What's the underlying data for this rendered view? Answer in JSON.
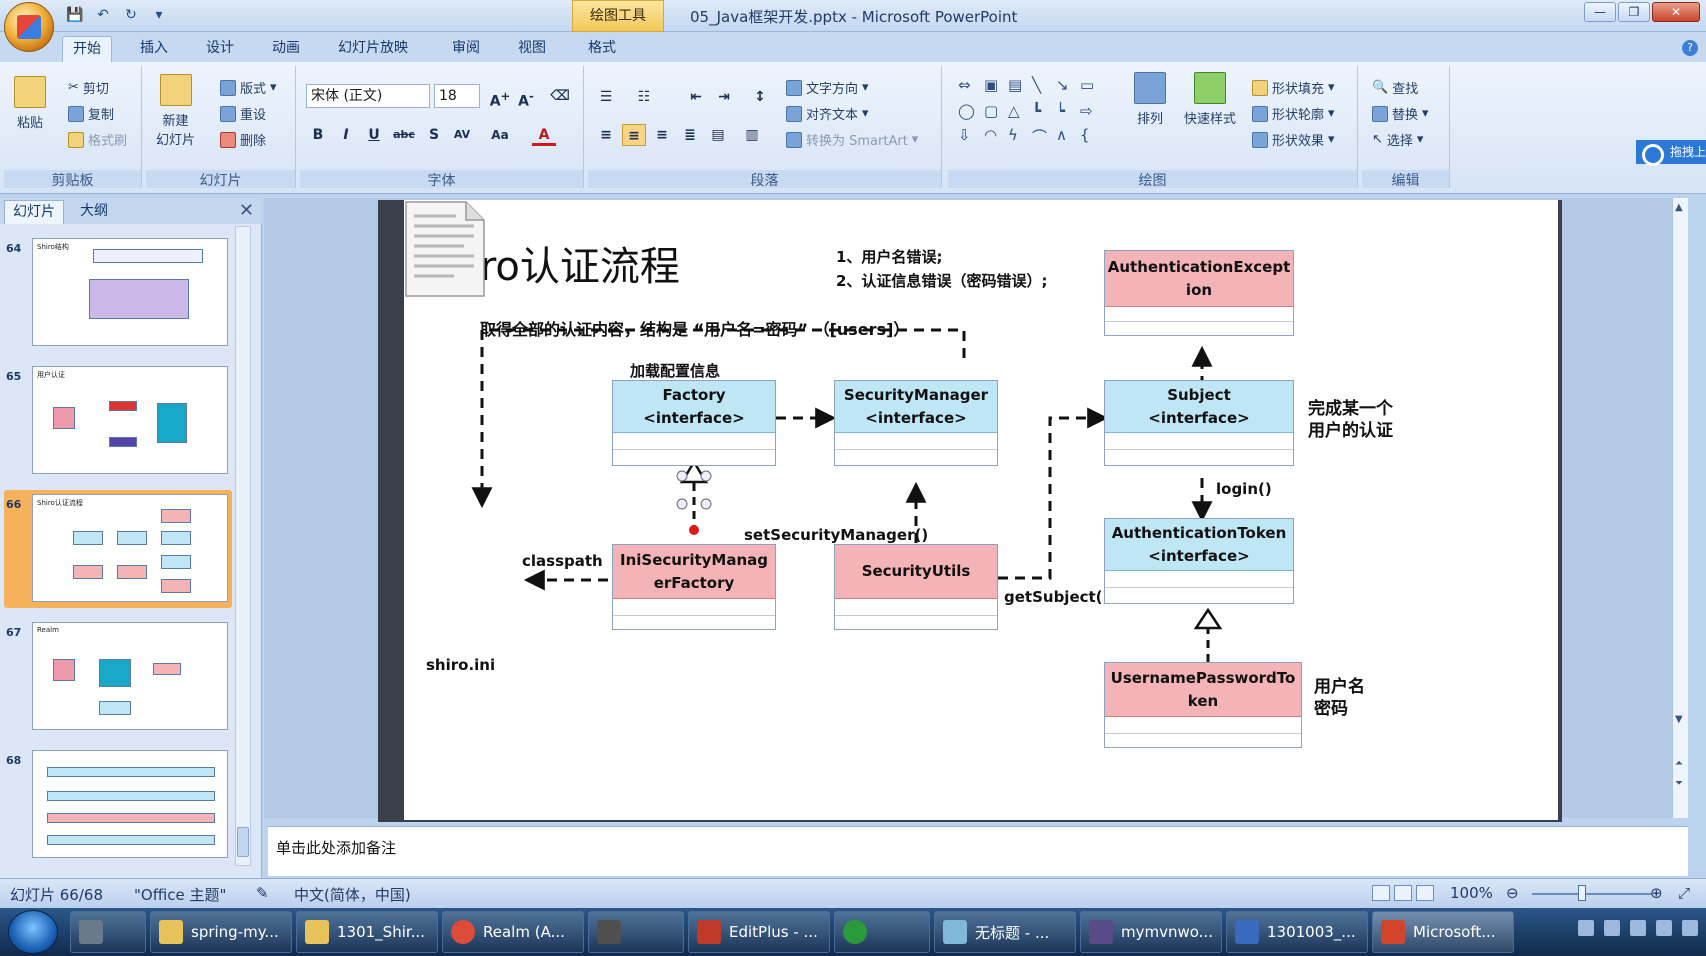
{
  "titlebar": {
    "context_tab": "绘图工具",
    "title": "05_Java框架开发.pptx - Microsoft PowerPoint"
  },
  "tabs": [
    "开始",
    "插入",
    "设计",
    "动画",
    "幻灯片放映",
    "审阅",
    "视图",
    "格式"
  ],
  "ribbon": {
    "clipboard": {
      "paste": "粘贴",
      "cut": "剪切",
      "copy": "复制",
      "format_painter": "格式刷",
      "label": "剪贴板"
    },
    "slides": {
      "new_slide": "新建\n幻灯片",
      "layout": "版式",
      "reset": "重设",
      "delete": "删除",
      "label": "幻灯片"
    },
    "font": {
      "name": "宋体 (正文)",
      "size": "18",
      "label": "字体"
    },
    "paragraph": {
      "text_direction": "文字方向",
      "align_text": "对齐文本",
      "smartart": "转换为 SmartArt",
      "label": "段落"
    },
    "drawing": {
      "arrange": "排列",
      "quick_styles": "快速样式",
      "shape_fill": "形状填充",
      "shape_outline": "形状轮廓",
      "shape_effects": "形状效果",
      "label": "绘图"
    },
    "editing": {
      "find": "查找",
      "replace": "替换",
      "select": "选择",
      "label": "编辑"
    },
    "share": "拖拽上"
  },
  "panel": {
    "tab_slides": "幻灯片",
    "tab_outline": "大纲",
    "thumbnails": [
      {
        "num": "64",
        "title": "Shiro结构"
      },
      {
        "num": "65",
        "title": "用户认证"
      },
      {
        "num": "66",
        "title": "Shiro认证流程"
      },
      {
        "num": "67",
        "title": "Realm"
      },
      {
        "num": "68",
        "title": ""
      }
    ]
  },
  "slide": {
    "title": "Shiro认证流程",
    "errors_1": "1、用户名错误;",
    "errors_2": "2、认证信息错误（密码错误）;",
    "get_all": "取得全部的认证内容，结构是 “用户名=密码” （[users]）",
    "load_config": "加载配置信息",
    "classpath": "classpath",
    "shiro_ini": "shiro.ini",
    "set_sm": "setSecurityManager()",
    "get_subject": "getSubject()",
    "login": "login()",
    "complete_1": "完成某一个",
    "complete_2": "用户的认证",
    "user_pwd_1": "用户名",
    "user_pwd_2": "密码",
    "boxes": {
      "factory": "Factory\n<interface>",
      "security_manager": "SecurityManager\n<interface>",
      "subject": "Subject\n<interface>",
      "auth_exception": "AuthenticationExcept\nion",
      "ini_factory": "IniSecurityManag\nerFactory",
      "security_utils": "SecurityUtils",
      "auth_token": "AuthenticationToken\n<interface>",
      "up_token": "UsernamePasswordTo\nken"
    }
  },
  "notes": "单击此处添加备注",
  "status": {
    "slide_counter": "幻灯片 66/68",
    "theme": "\"Office 主题\"",
    "language": "中文(简体，中国)",
    "zoom": "100%"
  },
  "taskbar": [
    {
      "label": "spring-my...",
      "color": "#e8c25a"
    },
    {
      "label": "1301_Shir...",
      "color": "#e8c25a"
    },
    {
      "label": "Realm (A...",
      "color": "#dd4b39"
    },
    {
      "label": "",
      "color": "#4f4f4f"
    },
    {
      "label": "EditPlus - ...",
      "color": "#c03a2a"
    },
    {
      "label": "",
      "color": "#2a9a3a"
    },
    {
      "label": "无标题 - ...",
      "color": "#7fb8d8"
    },
    {
      "label": "mymvnwo...",
      "color": "#5a4a8a"
    },
    {
      "label": "1301003_...",
      "color": "#3a6ac0"
    },
    {
      "label": "Microsoft...",
      "color": "#d2452a"
    }
  ]
}
